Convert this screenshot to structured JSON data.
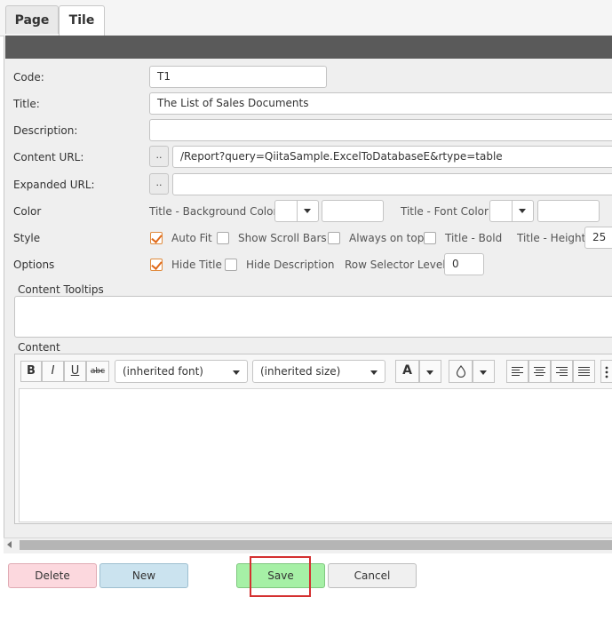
{
  "tabs": [
    {
      "label": "Page"
    },
    {
      "label": "Tile"
    }
  ],
  "form": {
    "code": {
      "label": "Code:",
      "value": "T1"
    },
    "title": {
      "label": "Title:",
      "value": "The List of Sales Documents"
    },
    "description": {
      "label": "Description:",
      "value": ""
    },
    "content_url": {
      "label": "Content URL:",
      "button": "..",
      "value": "/Report?query=QiitaSample.ExcelToDatabaseE&rtype=table"
    },
    "expanded_url": {
      "label": "Expanded URL:",
      "button": "..",
      "value": ""
    },
    "color": {
      "label": "Color",
      "title_bg_label": "Title - Background Color:",
      "title_font_label": "Title - Font Color:"
    },
    "style": {
      "label": "Style",
      "auto_fit": {
        "label": "Auto Fit",
        "checked": true
      },
      "show_scroll_bars": {
        "label": "Show Scroll Bars",
        "checked": false
      },
      "always_on_top": {
        "label": "Always on top",
        "checked": false
      },
      "title_bold": {
        "label": "Title - Bold",
        "checked": false
      },
      "title_height_label": "Title - Height",
      "title_height_value": "25"
    },
    "options": {
      "label": "Options",
      "hide_title": {
        "label": "Hide Title",
        "checked": true
      },
      "hide_description": {
        "label": "Hide Description",
        "checked": false
      },
      "row_selector_label": "Row Selector Level",
      "row_selector_value": "0"
    },
    "content_tooltips": {
      "label": "Content Tooltips",
      "value": ""
    },
    "content": {
      "label": "Content"
    }
  },
  "editor_toolbar": {
    "bold": "B",
    "italic": "I",
    "underline": "U",
    "strike": "abc",
    "font": "(inherited font)",
    "size": "(inherited size)",
    "font_color": "A"
  },
  "buttons": {
    "delete": "Delete",
    "new": "New",
    "save": "Save",
    "cancel": "Cancel"
  },
  "colors": {
    "accent_check": "#e06a1a",
    "delete_bg": "#fcd8de",
    "new_bg": "#cbe3ef",
    "save_bg": "#a6f0a6",
    "highlight": "#d43030"
  }
}
